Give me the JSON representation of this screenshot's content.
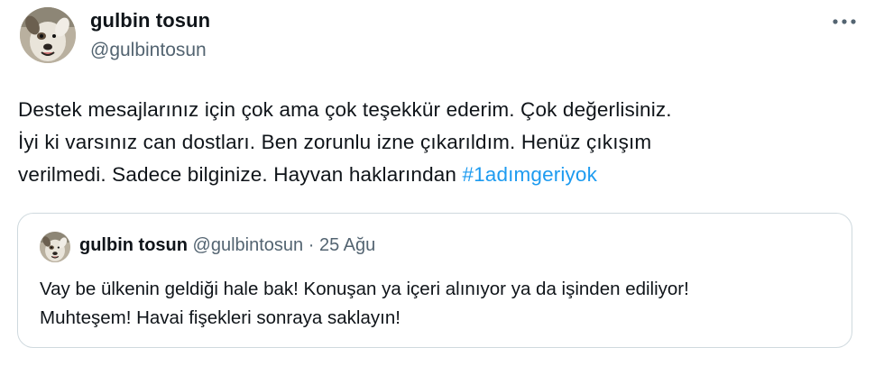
{
  "author": {
    "display_name": "gulbin tosun",
    "handle": "@gulbintosun",
    "avatar_icon": "dog-avatar"
  },
  "more_icon": "more-horizontal-icon",
  "tweet": {
    "lines": [
      "Destek mesajlarınız için çok ama çok teşekkür ederim. Çok değerlisiniz.",
      "İyi ki varsınız can dostları. Ben zorunlu izne çıkarıldım. Henüz çıkışım",
      "verilmedi. Sadece bilginize. Hayvan haklarından "
    ],
    "hashtag": "#1adımgeriyok"
  },
  "quoted": {
    "display_name": "gulbin tosun",
    "handle": "@gulbintosun",
    "separator": "·",
    "date": "25 Ağu",
    "lines": [
      "Vay be ülkenin geldiği hale bak! Konuşan ya içeri alınıyor ya da işinden ediliyor!",
      "Muhteşem! Havai fişekleri sonraya saklayın!"
    ]
  },
  "colors": {
    "text": "#0f1419",
    "secondary": "#536471",
    "link": "#1d9bf0",
    "border": "#cfd9de"
  }
}
